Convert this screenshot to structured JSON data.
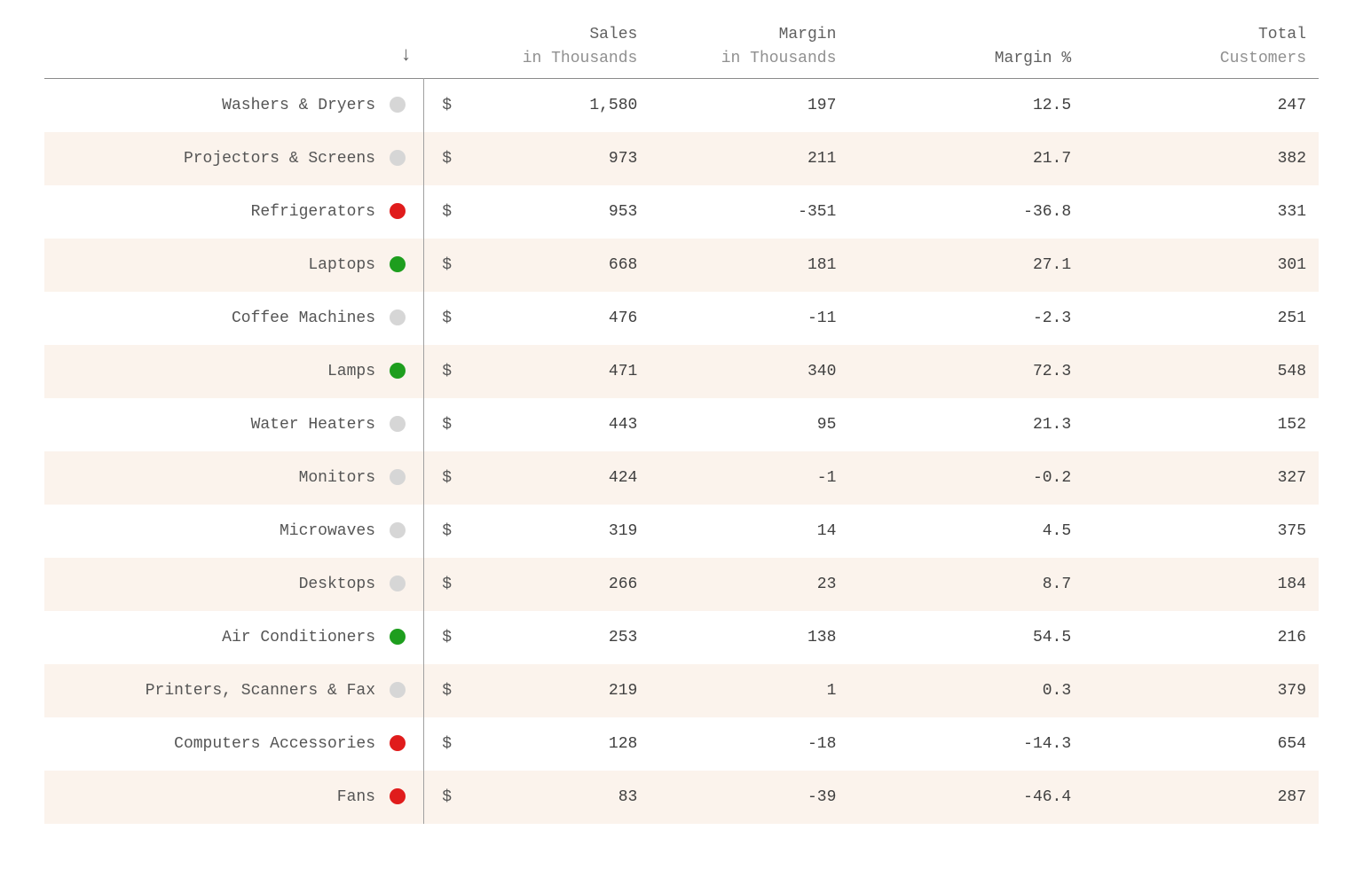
{
  "chart_data": {
    "type": "table",
    "title": "",
    "sort_column": "Sales",
    "sort_direction": "desc",
    "status_colors": {
      "grey": "#d6d6d6",
      "red": "#e01c1c",
      "green": "#1e9e1e"
    },
    "columns": [
      {
        "key": "category",
        "label": "",
        "sub": ""
      },
      {
        "key": "sort",
        "label": "↓",
        "sub": ""
      },
      {
        "key": "sales",
        "label": "Sales",
        "sub": "in Thousands",
        "currency": "$"
      },
      {
        "key": "margin",
        "label": "Margin",
        "sub": "in Thousands"
      },
      {
        "key": "margin_pct",
        "label": "Margin %",
        "sub": ""
      },
      {
        "key": "customers",
        "label": "Total",
        "sub": "Customers"
      }
    ],
    "rows": [
      {
        "category": "Washers & Dryers",
        "status": "grey",
        "sales": "1,580",
        "margin": "197",
        "margin_pct": "12.5",
        "customers": "247"
      },
      {
        "category": "Projectors & Screens",
        "status": "grey",
        "sales": "973",
        "margin": "211",
        "margin_pct": "21.7",
        "customers": "382"
      },
      {
        "category": "Refrigerators",
        "status": "red",
        "sales": "953",
        "margin": "-351",
        "margin_pct": "-36.8",
        "customers": "331"
      },
      {
        "category": "Laptops",
        "status": "green",
        "sales": "668",
        "margin": "181",
        "margin_pct": "27.1",
        "customers": "301"
      },
      {
        "category": "Coffee Machines",
        "status": "grey",
        "sales": "476",
        "margin": "-11",
        "margin_pct": "-2.3",
        "customers": "251"
      },
      {
        "category": "Lamps",
        "status": "green",
        "sales": "471",
        "margin": "340",
        "margin_pct": "72.3",
        "customers": "548"
      },
      {
        "category": "Water Heaters",
        "status": "grey",
        "sales": "443",
        "margin": "95",
        "margin_pct": "21.3",
        "customers": "152"
      },
      {
        "category": "Monitors",
        "status": "grey",
        "sales": "424",
        "margin": "-1",
        "margin_pct": "-0.2",
        "customers": "327"
      },
      {
        "category": "Microwaves",
        "status": "grey",
        "sales": "319",
        "margin": "14",
        "margin_pct": "4.5",
        "customers": "375"
      },
      {
        "category": "Desktops",
        "status": "grey",
        "sales": "266",
        "margin": "23",
        "margin_pct": "8.7",
        "customers": "184"
      },
      {
        "category": "Air Conditioners",
        "status": "green",
        "sales": "253",
        "margin": "138",
        "margin_pct": "54.5",
        "customers": "216"
      },
      {
        "category": "Printers, Scanners & Fax",
        "status": "grey",
        "sales": "219",
        "margin": "1",
        "margin_pct": "0.3",
        "customers": "379"
      },
      {
        "category": "Computers Accessories",
        "status": "red",
        "sales": "128",
        "margin": "-18",
        "margin_pct": "-14.3",
        "customers": "654"
      },
      {
        "category": "Fans",
        "status": "red",
        "sales": "83",
        "margin": "-39",
        "margin_pct": "-46.4",
        "customers": "287"
      }
    ]
  }
}
